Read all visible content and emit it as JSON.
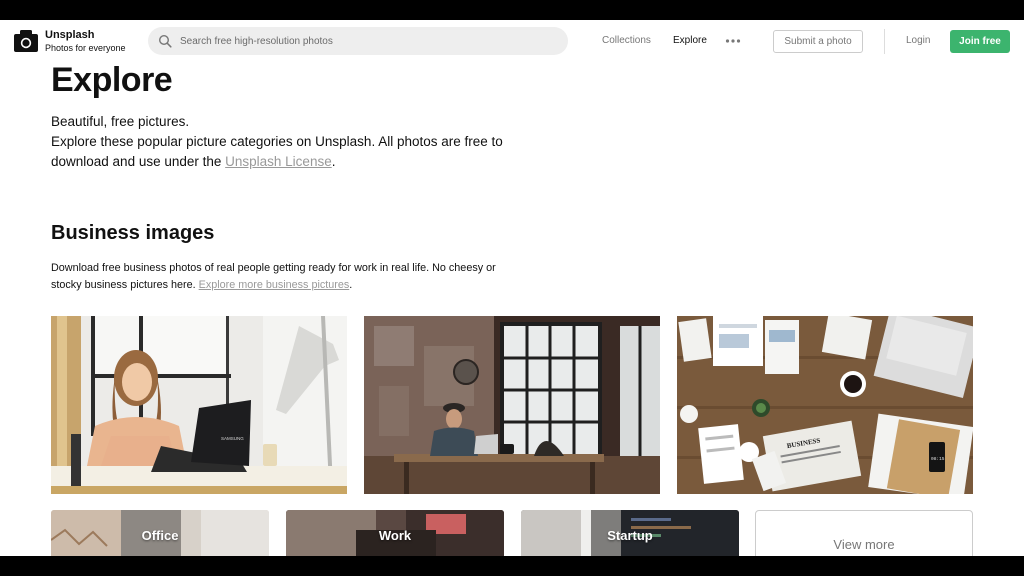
{
  "header": {
    "brand_name": "Unsplash",
    "brand_tagline": "Photos for everyone",
    "search_placeholder": "Search free high-resolution photos",
    "nav": [
      {
        "label": "Collections",
        "active": false
      },
      {
        "label": "Explore",
        "active": true
      }
    ],
    "more_icon": "ellipsis-icon",
    "submit_label": "Submit a photo",
    "login_label": "Login",
    "join_label": "Join free",
    "join_color": "#3cb46e"
  },
  "hero": {
    "title": "Explore",
    "line1": "Beautiful, free pictures.",
    "line2_before_link": "Explore these popular picture categories on Unsplash. All photos are free to download and use under the ",
    "license_link": "Unsplash License",
    "line2_after_link": "."
  },
  "business": {
    "title": "Business images",
    "desc_before_link": "Download free business photos of real people getting ready for work in real life. No cheesy or stocky business pictures here. ",
    "link": "Explore more business pictures",
    "desc_after_link": ".",
    "photos": [
      {
        "name": "woman-laptop-office-photo",
        "laptop_brand": "SAMSUNG"
      },
      {
        "name": "man-laptop-brick-loft-photo"
      },
      {
        "name": "desk-newspaper-business-flatlay-photo",
        "paper_heading": "BUSINESS",
        "phone_time": "08:15"
      }
    ]
  },
  "categories": [
    {
      "label": "Office"
    },
    {
      "label": "Work"
    },
    {
      "label": "Startup"
    }
  ],
  "view_more_label": "View more"
}
